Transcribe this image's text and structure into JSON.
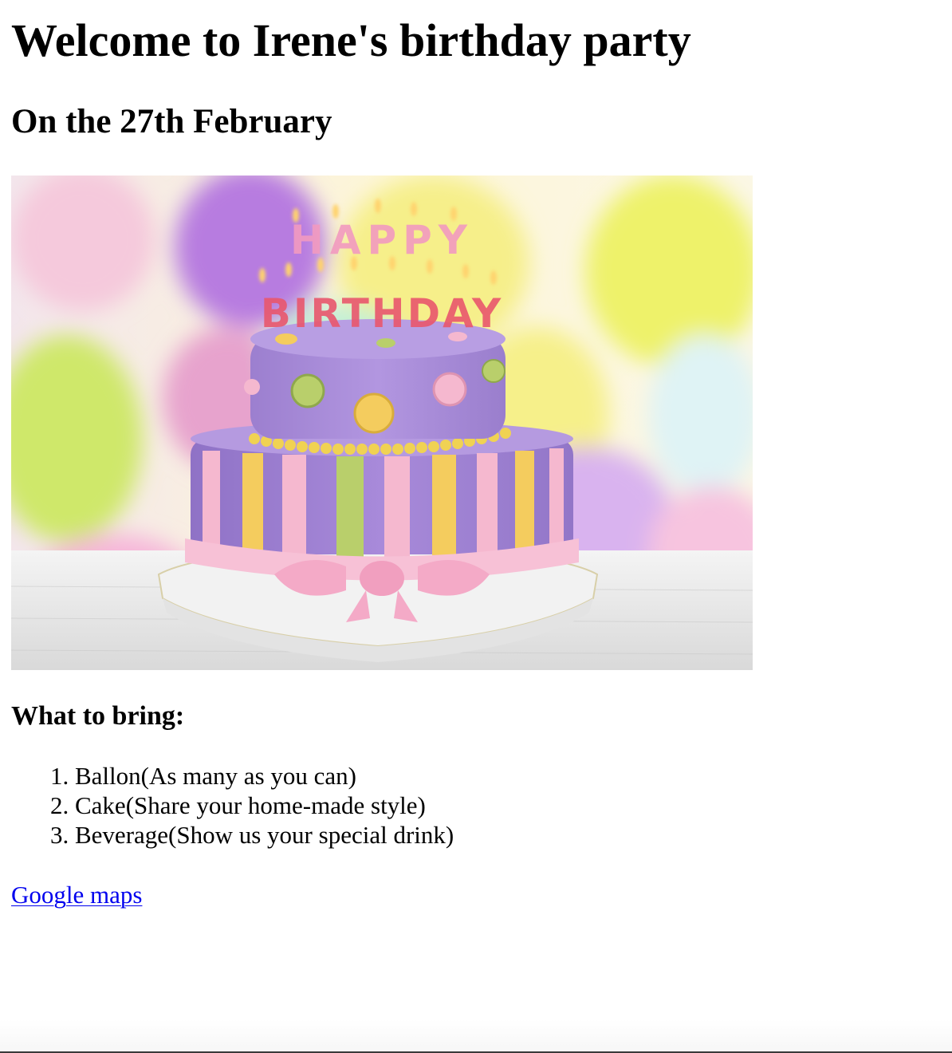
{
  "heading": "Welcome to Irene's birthday party",
  "date_line": "On the 27th February",
  "image": {
    "alt": "Birthday cake with HAPPY BIRTHDAY candles and balloons",
    "candles_top": "HAPPY",
    "candles_bottom": "BIRTHDAY"
  },
  "bring": {
    "title": "What to bring:",
    "items": [
      "Ballon(As many as you can)",
      "Cake(Share your home-made style)",
      "Beverage(Show us your special drink)"
    ]
  },
  "link": {
    "label": "Google maps"
  },
  "colors": {
    "link": "#0000ee",
    "cake_purple": "#a98ad9",
    "ribbon_pink": "#f5b8cf",
    "ribbon_yellow": "#f4cc5e",
    "ribbon_green": "#b9cf6b"
  }
}
